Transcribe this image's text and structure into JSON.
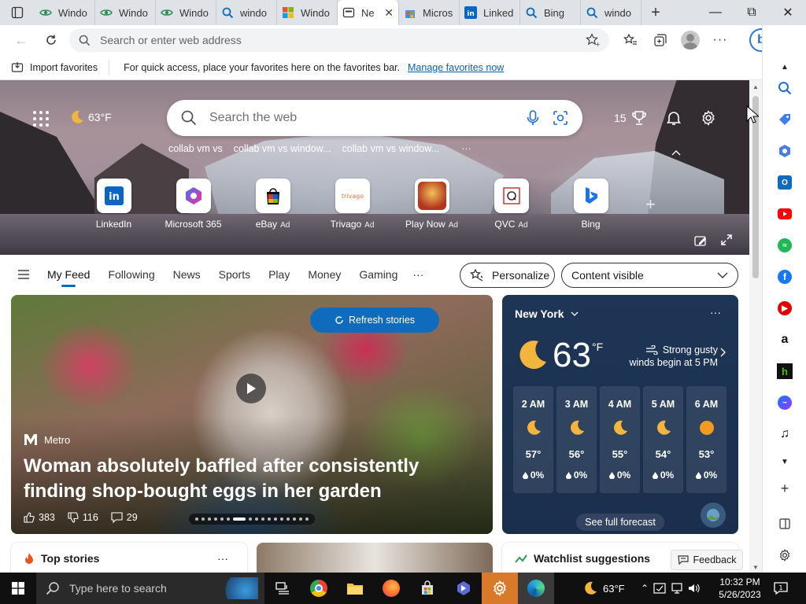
{
  "tabs": [
    {
      "label": "Windo",
      "icon": "copilot-eye-icon",
      "color": "#2e8b57"
    },
    {
      "label": "Windo",
      "icon": "copilot-eye-icon",
      "color": "#2e8b57"
    },
    {
      "label": "Windo",
      "icon": "copilot-eye-icon",
      "color": "#2e8b57"
    },
    {
      "label": "windo",
      "icon": "bing-search-icon",
      "color": "#0f6cbd"
    },
    {
      "label": "Windo",
      "icon": "windows-logo-icon",
      "color": "#f25022"
    },
    {
      "label": "Ne",
      "icon": "new-tab-icon",
      "color": "#333333"
    },
    {
      "label": "Micros",
      "icon": "microsoft-store-icon",
      "color": "#0078d4"
    },
    {
      "label": "Linked",
      "icon": "linkedin-icon",
      "color": "#0a66c2"
    },
    {
      "label": "Bing",
      "icon": "bing-search-icon",
      "color": "#0f6cbd"
    },
    {
      "label": "windo",
      "icon": "bing-search-icon",
      "color": "#0f6cbd"
    }
  ],
  "address": {
    "placeholder": "Search or enter web address"
  },
  "favorites_bar": {
    "import_label": "Import favorites",
    "message": "For quick access, place your favorites here on the favorites bar.",
    "manage_link": "Manage favorites now"
  },
  "hero": {
    "weather_temp": "63°F",
    "search_placeholder": "Search the web",
    "trending": [
      "collab vm vs",
      "collab vm vs window...",
      "collab vm vs window..."
    ],
    "more_trending": "···",
    "rewards_points": "15",
    "quick_links": [
      {
        "label": "LinkedIn",
        "ad": "",
        "icon": "linkedin-icon"
      },
      {
        "label": "Microsoft 365",
        "ad": "",
        "icon": "microsoft-365-icon"
      },
      {
        "label": "eBay",
        "ad": "Ad",
        "icon": "ebay-icon"
      },
      {
        "label": "Trivago",
        "ad": "Ad",
        "icon": "trivago-icon"
      },
      {
        "label": "Play Now",
        "ad": "Ad",
        "icon": "play-now-icon"
      },
      {
        "label": "QVC",
        "ad": "Ad",
        "icon": "qvc-icon"
      },
      {
        "label": "Bing",
        "ad": "",
        "icon": "bing-icon"
      }
    ],
    "add_link": "+"
  },
  "feed_nav": {
    "items": [
      "My Feed",
      "Following",
      "News",
      "Sports",
      "Play",
      "Money",
      "Gaming"
    ],
    "more": "···",
    "personalize": "Personalize",
    "content_visible": "Content visible"
  },
  "story": {
    "refresh": "Refresh stories",
    "source": "Metro",
    "title": "Woman absolutely baffled after consistently finding shop-bought eggs in her garden",
    "likes": "383",
    "dislikes": "116",
    "comments": "29"
  },
  "weather": {
    "city": "New York",
    "more": "···",
    "temp": "63",
    "unit": "°F",
    "alert": "Strong gusty winds begin at 5 PM",
    "hours": [
      {
        "time": "2 AM",
        "temp": "57°",
        "precip": "0%",
        "icon": "moon-icon"
      },
      {
        "time": "3 AM",
        "temp": "56°",
        "precip": "0%",
        "icon": "moon-icon"
      },
      {
        "time": "4 AM",
        "temp": "55°",
        "precip": "0%",
        "icon": "moon-icon"
      },
      {
        "time": "5 AM",
        "temp": "54°",
        "precip": "0%",
        "icon": "moon-icon"
      },
      {
        "time": "6 AM",
        "temp": "53°",
        "precip": "0%",
        "icon": "sun-icon"
      }
    ],
    "forecast": "See full forecast"
  },
  "lower": {
    "top_stories": "Top stories",
    "top_more": "···",
    "watchlist": "Watchlist suggestions",
    "feedback": "Feedback"
  },
  "taskbar": {
    "search_placeholder": "Type here to search",
    "weather": "63°F",
    "time": "10:32 PM",
    "date": "5/26/2023"
  }
}
